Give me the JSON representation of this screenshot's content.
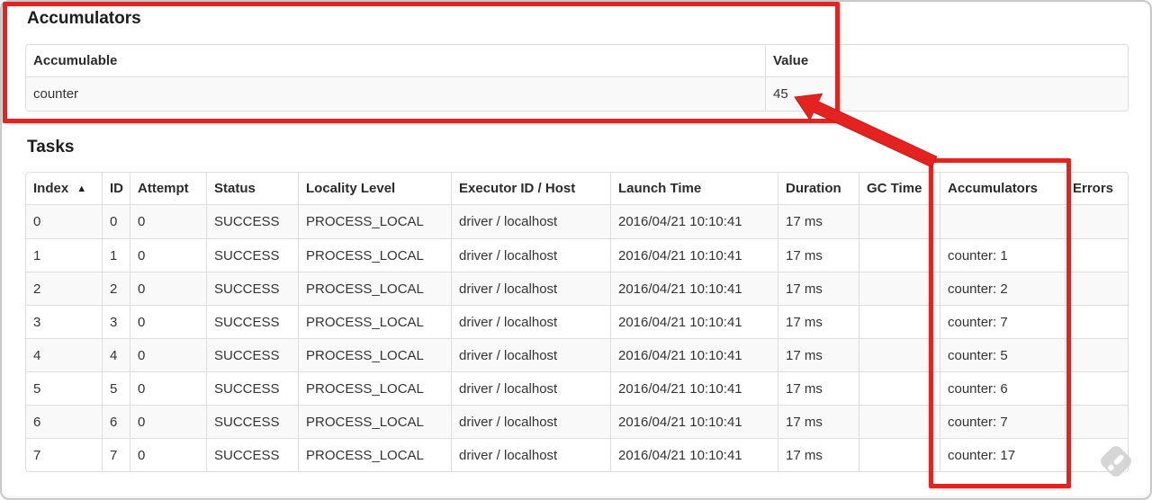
{
  "colors": {
    "annotation_red": "#e42320",
    "striped_row_bg": "#f9f9f9",
    "table_border": "#dddddd"
  },
  "accumulators": {
    "title": "Accumulators",
    "headers": [
      "Accumulable",
      "Value"
    ],
    "rows": [
      [
        "counter",
        "45"
      ]
    ]
  },
  "tasks": {
    "title": "Tasks",
    "sort_indicator": "▲",
    "headers": [
      "Index",
      "ID",
      "Attempt",
      "Status",
      "Locality Level",
      "Executor ID / Host",
      "Launch Time",
      "Duration",
      "GC Time",
      "Accumulators",
      "Errors"
    ],
    "rows": [
      [
        "0",
        "0",
        "0",
        "SUCCESS",
        "PROCESS_LOCAL",
        "driver / localhost",
        "2016/04/21 10:10:41",
        "17 ms",
        "",
        "",
        ""
      ],
      [
        "1",
        "1",
        "0",
        "SUCCESS",
        "PROCESS_LOCAL",
        "driver / localhost",
        "2016/04/21 10:10:41",
        "17 ms",
        "",
        "counter: 1",
        ""
      ],
      [
        "2",
        "2",
        "0",
        "SUCCESS",
        "PROCESS_LOCAL",
        "driver / localhost",
        "2016/04/21 10:10:41",
        "17 ms",
        "",
        "counter: 2",
        ""
      ],
      [
        "3",
        "3",
        "0",
        "SUCCESS",
        "PROCESS_LOCAL",
        "driver / localhost",
        "2016/04/21 10:10:41",
        "17 ms",
        "",
        "counter: 7",
        ""
      ],
      [
        "4",
        "4",
        "0",
        "SUCCESS",
        "PROCESS_LOCAL",
        "driver / localhost",
        "2016/04/21 10:10:41",
        "17 ms",
        "",
        "counter: 5",
        ""
      ],
      [
        "5",
        "5",
        "0",
        "SUCCESS",
        "PROCESS_LOCAL",
        "driver / localhost",
        "2016/04/21 10:10:41",
        "17 ms",
        "",
        "counter: 6",
        ""
      ],
      [
        "6",
        "6",
        "0",
        "SUCCESS",
        "PROCESS_LOCAL",
        "driver / localhost",
        "2016/04/21 10:10:41",
        "17 ms",
        "",
        "counter: 7",
        ""
      ],
      [
        "7",
        "7",
        "0",
        "SUCCESS",
        "PROCESS_LOCAL",
        "driver / localhost",
        "2016/04/21 10:10:41",
        "17 ms",
        "",
        "counter: 17",
        ""
      ]
    ]
  }
}
